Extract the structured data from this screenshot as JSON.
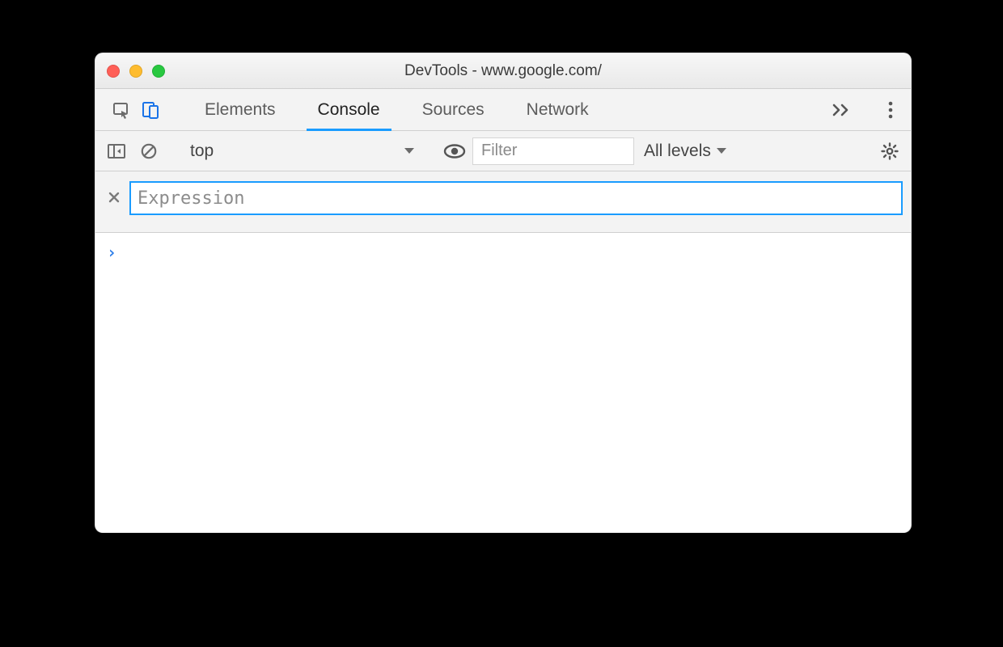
{
  "window": {
    "title": "DevTools - www.google.com/"
  },
  "tabs": {
    "elements": "Elements",
    "console": "Console",
    "sources": "Sources",
    "network": "Network",
    "active": "console"
  },
  "consoleToolbar": {
    "context": "top",
    "filter_placeholder": "Filter",
    "levels_label": "All levels"
  },
  "liveExpression": {
    "placeholder": "Expression",
    "value": ""
  },
  "prompt": {
    "symbol": "›"
  }
}
